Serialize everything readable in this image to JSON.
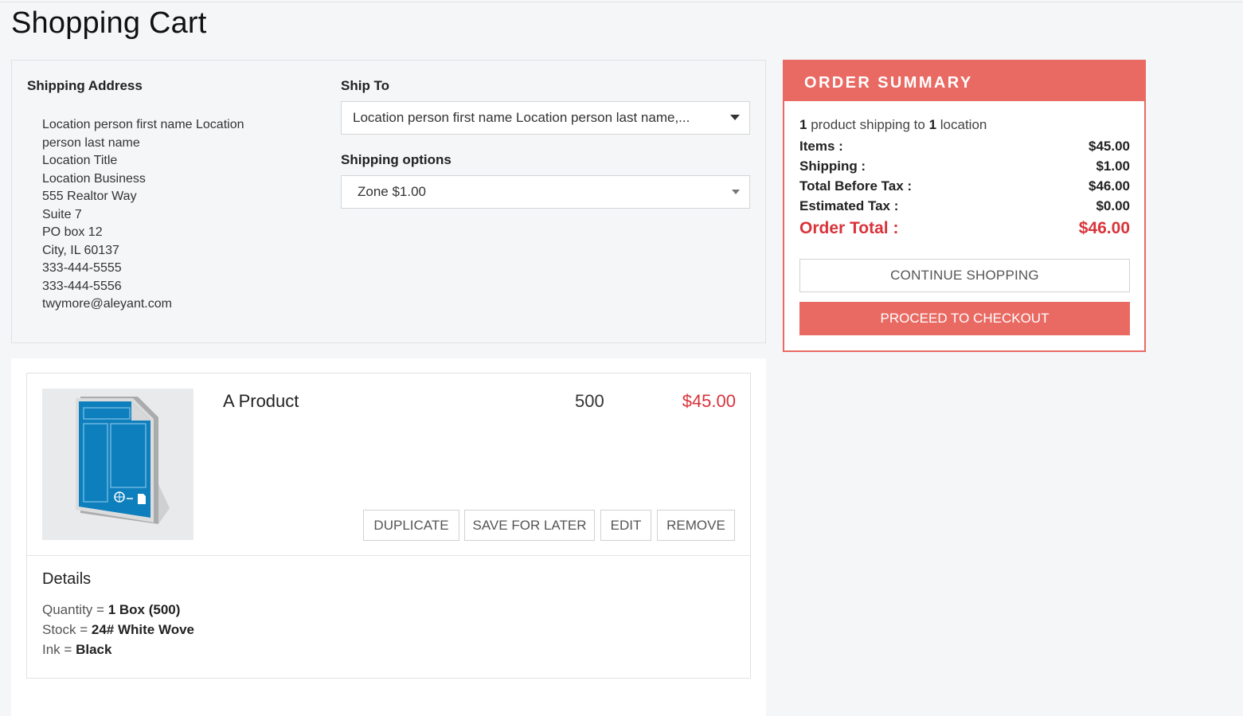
{
  "page": {
    "title": "Shopping Cart"
  },
  "shipping_address": {
    "heading": "Shipping Address",
    "lines": [
      "Location person first name Location person last name",
      "Location Title",
      "Location Business",
      "555 Realtor Way",
      "Suite 7",
      "PO box 12",
      "City, IL 60137",
      "333-444-5555",
      "333-444-5556",
      "twymore@aleyant.com"
    ]
  },
  "ship_to": {
    "label": "Ship To",
    "selected": "Location person first name Location person last name,..."
  },
  "shipping_options": {
    "label": "Shipping options",
    "selected": "Zone $1.00"
  },
  "order_summary": {
    "heading": "ORDER SUMMARY",
    "product_count": "1",
    "text_mid": " product shipping to ",
    "location_count": "1",
    "text_end": " location",
    "items_label": "Items :",
    "items_value": "$45.00",
    "shipping_label": "Shipping :",
    "shipping_value": "$1.00",
    "before_tax_label": "Total Before Tax :",
    "before_tax_value": "$46.00",
    "tax_label": "Estimated Tax :",
    "tax_value": "$0.00",
    "total_label": "Order Total :",
    "total_value": "$46.00",
    "continue_label": "CONTINUE SHOPPING",
    "checkout_label": "PROCEED TO CHECKOUT"
  },
  "cart_item": {
    "name": "A Product",
    "quantity": "500",
    "price": "$45.00",
    "actions": {
      "duplicate": "DUPLICATE",
      "save": "SAVE FOR LATER",
      "edit": "EDIT",
      "remove": "REMOVE"
    },
    "details_heading": "Details",
    "details": [
      {
        "label": "Quantity = ",
        "value": "1 Box (500)"
      },
      {
        "label": "Stock = ",
        "value": "24# White Wove"
      },
      {
        "label": "Ink = ",
        "value": "Black"
      }
    ]
  },
  "colors": {
    "accent": "#e96a63",
    "price": "#d9333a"
  },
  "icons": {
    "product_thumbnail": "document-web-icon",
    "dropdown": "caret-down-icon"
  }
}
